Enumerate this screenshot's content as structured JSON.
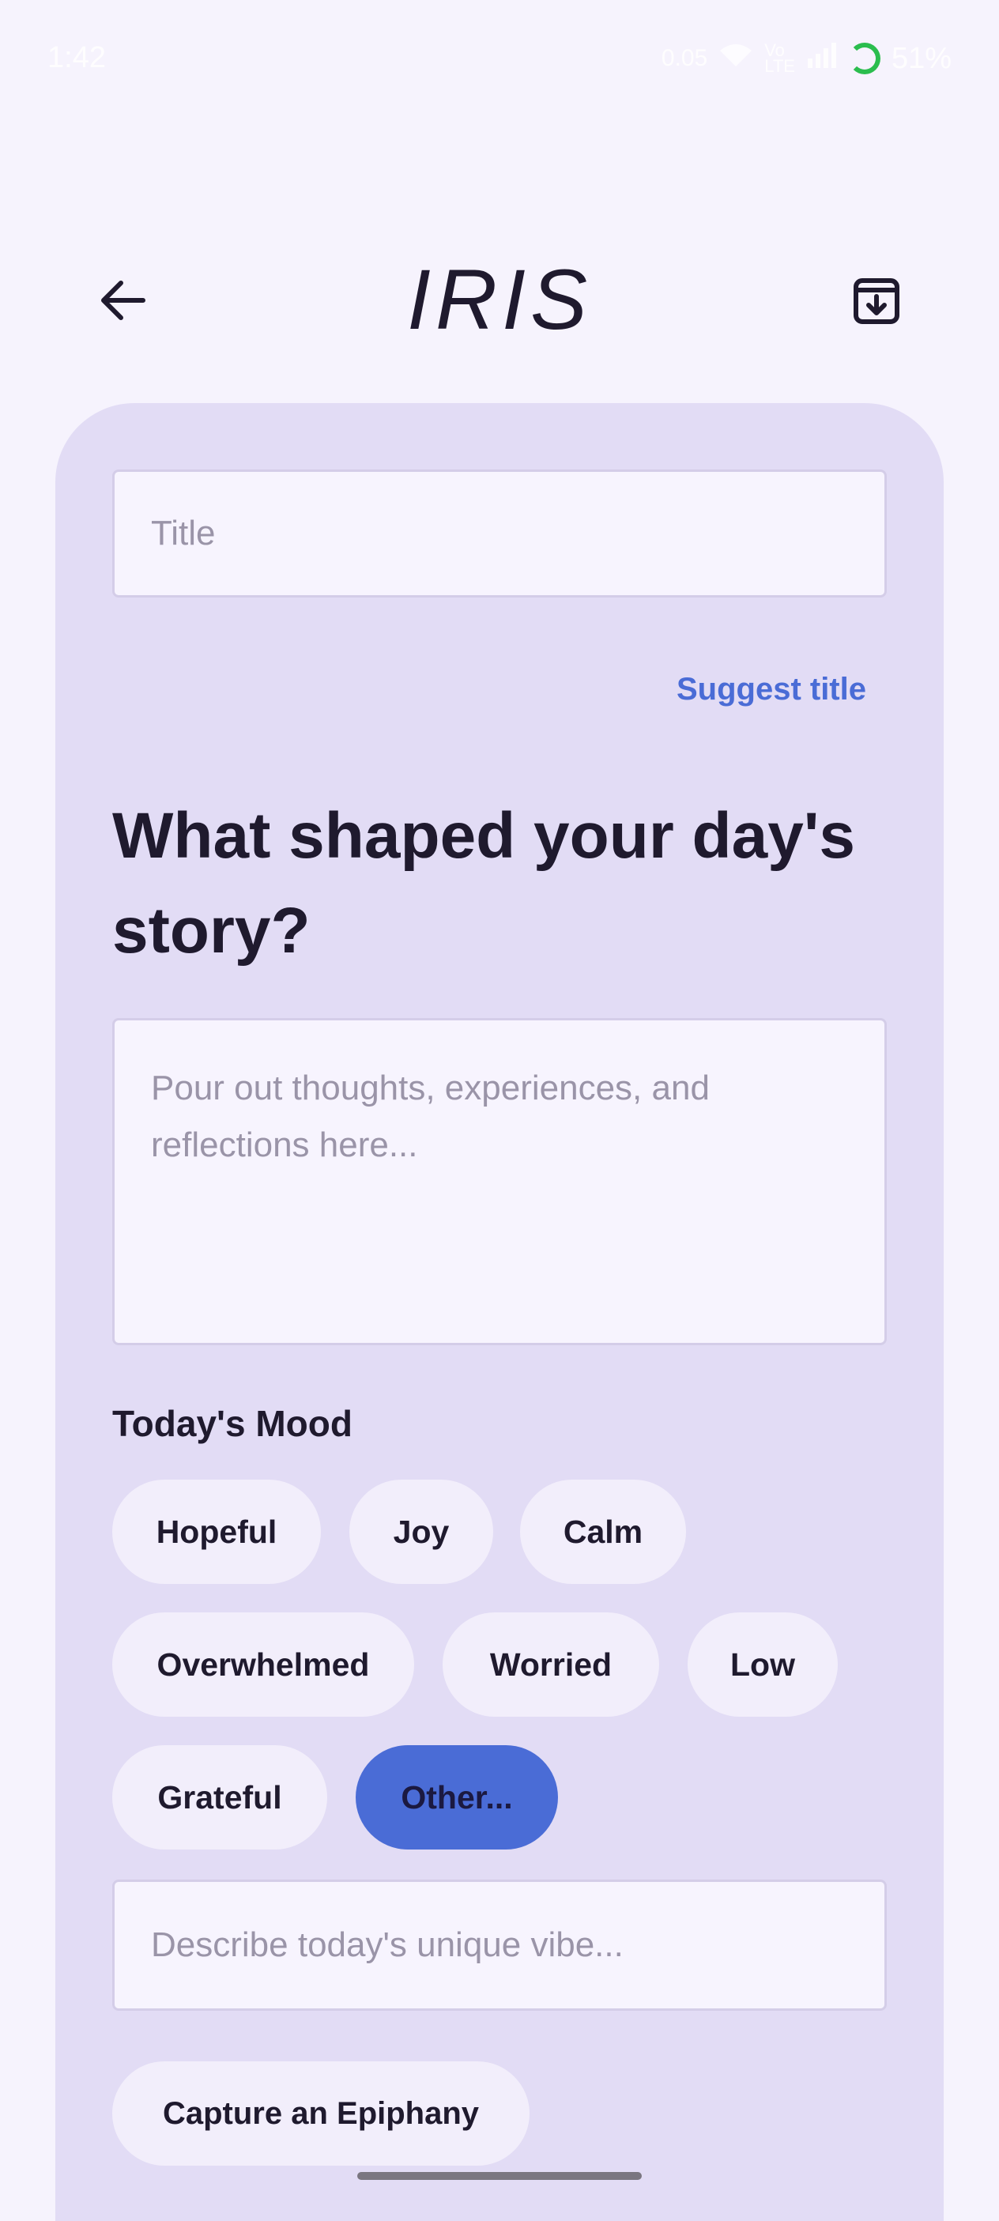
{
  "status_bar": {
    "time": "1:42",
    "net_speed": "0.05",
    "battery": "51%"
  },
  "app_bar": {
    "title": "IRIS",
    "back_icon": "arrow-left-icon",
    "archive_icon": "archive-download-icon"
  },
  "form": {
    "title_placeholder": "Title",
    "suggest_title_label": "Suggest title",
    "heading": "What shaped your day's story?",
    "entry_placeholder": "Pour out thoughts, experiences, and reflections here...",
    "mood_label": "Today's Mood",
    "moods": [
      {
        "label": "Hopeful",
        "selected": false
      },
      {
        "label": "Joy",
        "selected": false
      },
      {
        "label": "Calm",
        "selected": false
      },
      {
        "label": "Overwhelmed",
        "selected": false
      },
      {
        "label": "Worried",
        "selected": false
      },
      {
        "label": "Low",
        "selected": false
      },
      {
        "label": "Grateful",
        "selected": false
      },
      {
        "label": "Other...",
        "selected": true
      }
    ],
    "vibe_placeholder": "Describe today's unique vibe...",
    "epiphany_label": "Capture an Epiphany"
  },
  "colors": {
    "background": "#f6f3fd",
    "card": "#e2dcf5",
    "accent": "#4a6cd6"
  }
}
